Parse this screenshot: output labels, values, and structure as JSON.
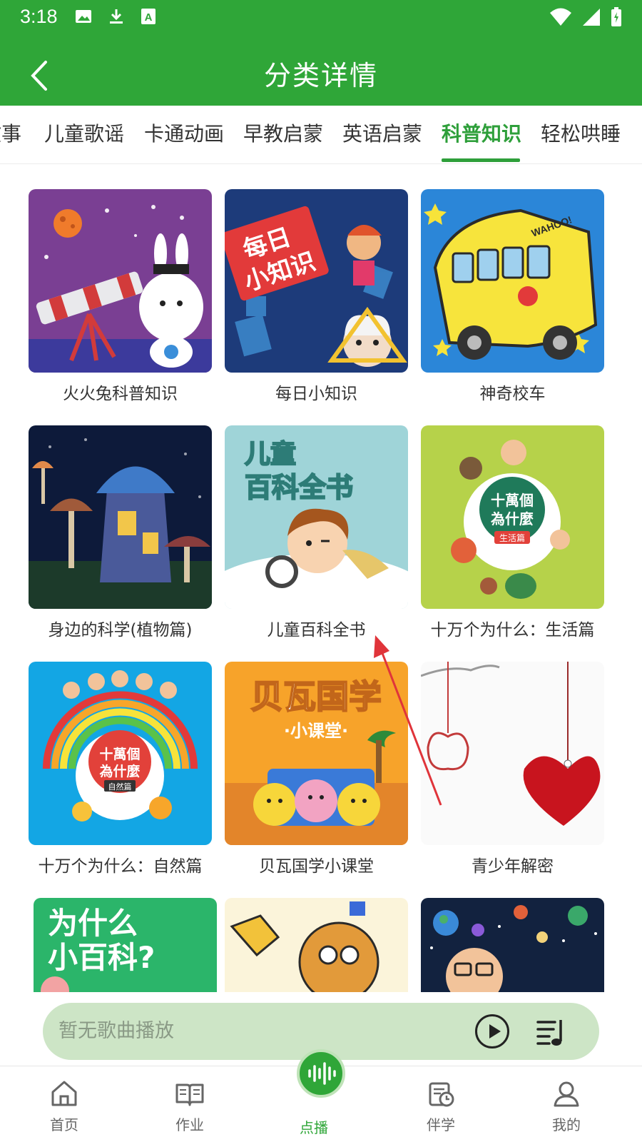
{
  "status_bar": {
    "time": "3:18"
  },
  "header": {
    "title": "分类详情",
    "back_icon": "chevron-left-icon"
  },
  "tabs": [
    {
      "label": "故事",
      "active": false
    },
    {
      "label": "儿童歌谣",
      "active": false
    },
    {
      "label": "卡通动画",
      "active": false
    },
    {
      "label": "早教启蒙",
      "active": false
    },
    {
      "label": "英语启蒙",
      "active": false
    },
    {
      "label": "科普知识",
      "active": true
    },
    {
      "label": "轻松哄睡",
      "active": false
    }
  ],
  "albums": [
    {
      "title": "火火兔科普知识"
    },
    {
      "title": "每日小知识",
      "cover_text": "每日小知识"
    },
    {
      "title": "神奇校车",
      "cover_text": "WAHOO!"
    },
    {
      "title": "身边的科学(植物篇)"
    },
    {
      "title": "儿童百科全书",
      "cover_text": "儿童百科全书"
    },
    {
      "title": "十万个为什么：生活篇",
      "cover_text": "十萬個為什麼",
      "cover_sub": "生活篇"
    },
    {
      "title": "十万个为什么：自然篇",
      "cover_text": "十萬個為什麼",
      "cover_sub": "自然篇"
    },
    {
      "title": "贝瓦国学小课堂",
      "cover_text": "贝瓦国学",
      "cover_sub": "·小课堂·"
    },
    {
      "title": "青少年解密"
    },
    {
      "title": "",
      "cover_text": "为什么小百科?"
    },
    {
      "title": ""
    },
    {
      "title": ""
    }
  ],
  "player": {
    "status": "暂无歌曲播放"
  },
  "bottom_nav": [
    {
      "label": "首页",
      "icon": "home-icon",
      "active": false
    },
    {
      "label": "作业",
      "icon": "book-icon",
      "active": false
    },
    {
      "label": "点播",
      "icon": "sound-wave-icon",
      "active": true
    },
    {
      "label": "伴学",
      "icon": "calendar-clock-icon",
      "active": false
    },
    {
      "label": "我的",
      "icon": "user-icon",
      "active": false
    }
  ],
  "colors": {
    "brand": "#2fa638",
    "active_tab": "#2e9f3a",
    "player_bg": "#cde5c6",
    "annotation": "#e0343a"
  }
}
